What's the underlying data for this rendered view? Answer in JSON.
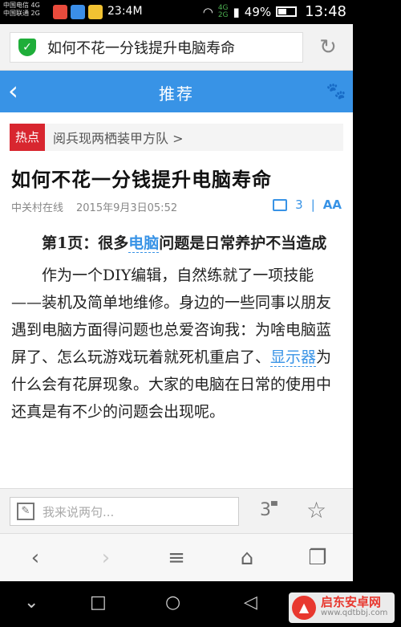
{
  "status_bar": {
    "carrier1": "中国电信 4G",
    "carrier2": "中国联通 2G",
    "small_time": "23:4M",
    "net1": "4G",
    "net2": "2G",
    "battery": "49%",
    "clock": "13:48"
  },
  "address_bar": {
    "title": "如何不花一分钱提升电脑寿命"
  },
  "header": {
    "title": "推荐"
  },
  "hot": {
    "badge": "热点",
    "link": "阅兵现两栖装甲方队 >"
  },
  "article": {
    "title": "如何不花一分钱提升电脑寿命",
    "source": "中关村在线",
    "date": "2015年9月3日05:52",
    "comment_count": "3",
    "font_toggle": "AA",
    "lead_prefix": "第1页：很多",
    "lead_keyword": "电脑",
    "lead_suffix": "问题是日常养护不当造成",
    "body_part1": "作为一个DIY编辑，自然练就了一项技能——装机及简单地维修。身边的一些同事以朋友遇到电脑方面得问题也总爱咨询我：为啥电脑蓝屏了、怎么玩游戏玩着就死机重启了、",
    "body_keyword": "显示器",
    "body_part2": "为什么会有花屏现象。大家的电脑在日常的使用中还真是有不少的问题会出现呢。"
  },
  "comment_bar": {
    "placeholder": "我来说两句...",
    "count": "3"
  },
  "watermark": {
    "main": "启东安卓网",
    "sub": "www.qdtbbj.com"
  }
}
